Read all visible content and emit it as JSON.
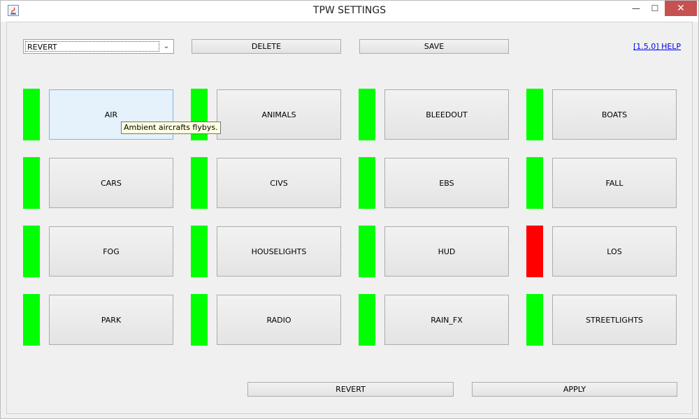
{
  "window": {
    "title": "TPW SETTINGS",
    "minimize_glyph": "—",
    "maximize_glyph": "☐",
    "close_glyph": "✕"
  },
  "toolbar": {
    "profile_value": "REVERT",
    "delete_label": "DELETE",
    "save_label": "SAVE",
    "help_link": "[1.5.0] HELP"
  },
  "modules": [
    {
      "label": "AIR",
      "enabled": true
    },
    {
      "label": "ANIMALS",
      "enabled": true
    },
    {
      "label": "BLEEDOUT",
      "enabled": true
    },
    {
      "label": "BOATS",
      "enabled": true
    },
    {
      "label": "CARS",
      "enabled": true
    },
    {
      "label": "CIVS",
      "enabled": true
    },
    {
      "label": "EBS",
      "enabled": true
    },
    {
      "label": "FALL",
      "enabled": true
    },
    {
      "label": "FOG",
      "enabled": true
    },
    {
      "label": "HOUSELIGHTS",
      "enabled": true
    },
    {
      "label": "HUD",
      "enabled": true
    },
    {
      "label": "LOS",
      "enabled": false
    },
    {
      "label": "PARK",
      "enabled": true
    },
    {
      "label": "RADIO",
      "enabled": true
    },
    {
      "label": "RAIN_FX",
      "enabled": true
    },
    {
      "label": "STREETLIGHTS",
      "enabled": true
    }
  ],
  "status_colors": {
    "enabled": "#00ff00",
    "disabled": "#ff0000"
  },
  "tooltip": {
    "text": "Ambient aircrafts flybys."
  },
  "footer": {
    "revert_label": "REVERT",
    "apply_label": "APPLY"
  }
}
